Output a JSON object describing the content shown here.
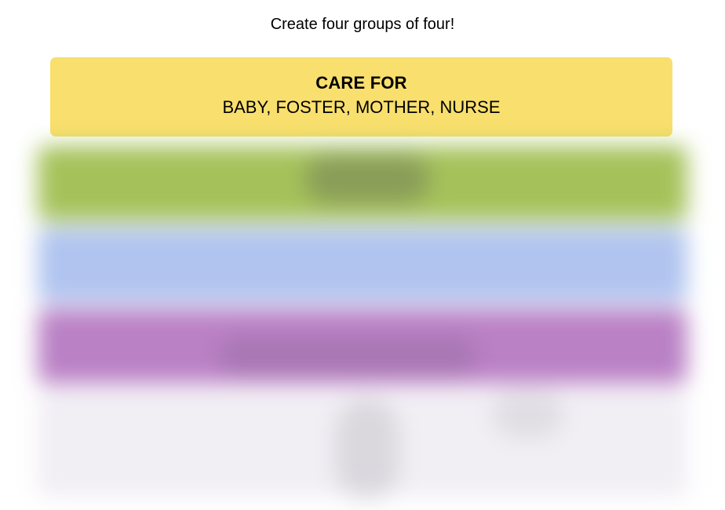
{
  "instructions": "Create four groups of four!",
  "solved_groups": [
    {
      "title": "CARE FOR",
      "members": "BABY, FOSTER, MOTHER, NURSE",
      "color": "#f9df6d"
    }
  ],
  "blurred_rows": [
    {
      "color": "#a5c25a"
    },
    {
      "color": "#b0c4ef"
    },
    {
      "color": "#ba81c5"
    },
    {
      "color": "#f1eef4"
    }
  ]
}
